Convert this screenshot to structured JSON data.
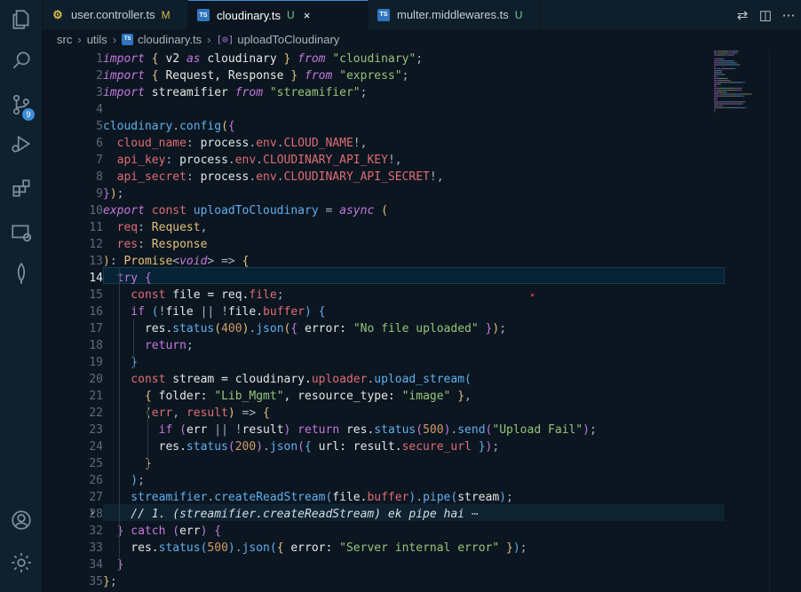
{
  "tabs": [
    {
      "label": "user.controller.ts",
      "status": "M",
      "icon": "js-settings-icon"
    },
    {
      "label": "cloudinary.ts",
      "status": "U",
      "close": "×",
      "icon": "typescript-icon"
    },
    {
      "label": "multer.middlewares.ts",
      "status": "U",
      "icon": "typescript-icon"
    }
  ],
  "tab_badge_ts": "TS",
  "activity_badge": "9",
  "breadcrumb": {
    "parts": [
      "src",
      "utils",
      "cloudinary.ts",
      "uploadToCloudinary"
    ],
    "separator": "›"
  },
  "line_numbers": [
    "1",
    "2",
    "3",
    "4",
    "5",
    "6",
    "7",
    "8",
    "9",
    "10",
    "11",
    "12",
    "13",
    "14",
    "15",
    "16",
    "17",
    "18",
    "19",
    "20",
    "21",
    "22",
    "23",
    "24",
    "25",
    "26",
    "27",
    "28",
    "32",
    "33",
    "34",
    "35"
  ],
  "current_line": "14",
  "fold_chevron": "›",
  "code_tokens": [
    [
      [
        "kw",
        "import"
      ],
      [
        "pun",
        " "
      ],
      [
        "br1",
        "{"
      ],
      [
        "var",
        " v2 "
      ],
      [
        "kw",
        "as"
      ],
      [
        "var",
        " cloudinary "
      ],
      [
        "br1",
        "}"
      ],
      [
        "pun",
        " "
      ],
      [
        "kw",
        "from"
      ],
      [
        "pun",
        " "
      ],
      [
        "str",
        "\"cloudinary\""
      ],
      [
        "pun",
        ";"
      ]
    ],
    [
      [
        "kw",
        "import"
      ],
      [
        "pun",
        " "
      ],
      [
        "br1",
        "{"
      ],
      [
        "var",
        " Request, Response "
      ],
      [
        "br1",
        "}"
      ],
      [
        "pun",
        " "
      ],
      [
        "kw",
        "from"
      ],
      [
        "pun",
        " "
      ],
      [
        "str",
        "\"express\""
      ],
      [
        "pun",
        ";"
      ]
    ],
    [
      [
        "kw",
        "import"
      ],
      [
        "var",
        " streamifier "
      ],
      [
        "kw",
        "from"
      ],
      [
        "pun",
        " "
      ],
      [
        "str",
        "\"streamifier\""
      ],
      [
        "pun",
        ";"
      ]
    ],
    [],
    [
      [
        "fn",
        "cloudinary"
      ],
      [
        "pun",
        "."
      ],
      [
        "fn",
        "config"
      ],
      [
        "br1",
        "("
      ],
      [
        "br2",
        "{"
      ]
    ],
    [
      [
        "prop",
        "  cloud_name"
      ],
      [
        "pun",
        ": "
      ],
      [
        "var",
        "process"
      ],
      [
        "pun",
        "."
      ],
      [
        "prop",
        "env"
      ],
      [
        "pun",
        "."
      ],
      [
        "env",
        "CLOUD_NAME"
      ],
      [
        "pun",
        "!,"
      ]
    ],
    [
      [
        "prop",
        "  api_key"
      ],
      [
        "pun",
        ": "
      ],
      [
        "var",
        "process"
      ],
      [
        "pun",
        "."
      ],
      [
        "prop",
        "env"
      ],
      [
        "pun",
        "."
      ],
      [
        "env",
        "CLOUDINARY_API_KEY"
      ],
      [
        "pun",
        "!,"
      ]
    ],
    [
      [
        "prop",
        "  api_secret"
      ],
      [
        "pun",
        ": "
      ],
      [
        "var",
        "process"
      ],
      [
        "pun",
        "."
      ],
      [
        "prop",
        "env"
      ],
      [
        "pun",
        "."
      ],
      [
        "env",
        "CLOUDINARY_API_SECRET"
      ],
      [
        "pun",
        "!,"
      ]
    ],
    [
      [
        "br2",
        "}"
      ],
      [
        "br1",
        ")"
      ],
      [
        "pun",
        ";"
      ]
    ],
    [
      [
        "kw",
        "export"
      ],
      [
        "pun",
        " "
      ],
      [
        "kb",
        "const"
      ],
      [
        "pun",
        " "
      ],
      [
        "fn",
        "uploadToCloudinary"
      ],
      [
        "pun",
        " = "
      ],
      [
        "kw",
        "async"
      ],
      [
        "pun",
        " "
      ],
      [
        "br1",
        "("
      ]
    ],
    [
      [
        "prop",
        "  req"
      ],
      [
        "pun",
        ": "
      ],
      [
        "type",
        "Request"
      ],
      [
        "pun",
        ","
      ]
    ],
    [
      [
        "prop",
        "  res"
      ],
      [
        "pun",
        ": "
      ],
      [
        "type",
        "Response"
      ]
    ],
    [
      [
        "br1",
        ")"
      ],
      [
        "pun",
        ": "
      ],
      [
        "type",
        "Promise"
      ],
      [
        "pun",
        "<"
      ],
      [
        "kw",
        "void"
      ],
      [
        "pun",
        "> => "
      ],
      [
        "br1",
        "{"
      ]
    ],
    [
      [
        "ctl",
        "  try"
      ],
      [
        "pun",
        " "
      ],
      [
        "br2",
        "{"
      ]
    ],
    [
      [
        "kb",
        "    const"
      ],
      [
        "var",
        " file = req."
      ],
      [
        "prop",
        "file"
      ],
      [
        "pun",
        ";"
      ]
    ],
    [
      [
        "ctl",
        "    if"
      ],
      [
        "pun",
        " "
      ],
      [
        "br3",
        "("
      ],
      [
        "pun",
        "!"
      ],
      [
        "var",
        "file "
      ],
      [
        "pun",
        "||"
      ],
      [
        "pun",
        " !"
      ],
      [
        "var",
        "file."
      ],
      [
        "prop",
        "buffer"
      ],
      [
        "br3",
        ")"
      ],
      [
        "pun",
        " "
      ],
      [
        "br3",
        "{"
      ]
    ],
    [
      [
        "var",
        "      res."
      ],
      [
        "fn",
        "status"
      ],
      [
        "br1",
        "("
      ],
      [
        "num",
        "400"
      ],
      [
        "br1",
        ")"
      ],
      [
        "pun",
        "."
      ],
      [
        "fn",
        "json"
      ],
      [
        "br1",
        "("
      ],
      [
        "br2",
        "{"
      ],
      [
        "var",
        " error: "
      ],
      [
        "str",
        "\"No file uploaded\""
      ],
      [
        "pun",
        " "
      ],
      [
        "br2",
        "}"
      ],
      [
        "br1",
        ")"
      ],
      [
        "pun",
        ";"
      ]
    ],
    [
      [
        "ctl",
        "      return"
      ],
      [
        "pun",
        ";"
      ]
    ],
    [
      [
        "br3",
        "    }"
      ]
    ],
    [
      [
        "kb",
        "    const"
      ],
      [
        "var",
        " stream = cloudinary."
      ],
      [
        "prop",
        "uploader"
      ],
      [
        "pun",
        "."
      ],
      [
        "fn",
        "upload_stream"
      ],
      [
        "br3",
        "("
      ]
    ],
    [
      [
        "br1",
        "      {"
      ],
      [
        "var",
        " folder: "
      ],
      [
        "str",
        "\"Lib_Mgmt\""
      ],
      [
        "var",
        ", resource_type: "
      ],
      [
        "str",
        "\"image\""
      ],
      [
        "pun",
        " "
      ],
      [
        "br1",
        "}"
      ],
      [
        "pun",
        ","
      ]
    ],
    [
      [
        "br1",
        "      ("
      ],
      [
        "prop",
        "err"
      ],
      [
        "pun",
        ", "
      ],
      [
        "prop",
        "result"
      ],
      [
        "br1",
        ")"
      ],
      [
        "pun",
        " => "
      ],
      [
        "br1",
        "{"
      ]
    ],
    [
      [
        "ctl",
        "        if"
      ],
      [
        "pun",
        " "
      ],
      [
        "br2",
        "("
      ],
      [
        "var",
        "err "
      ],
      [
        "pun",
        "||"
      ],
      [
        "pun",
        " !"
      ],
      [
        "var",
        "result"
      ],
      [
        "br2",
        ")"
      ],
      [
        "ctl",
        " return"
      ],
      [
        "var",
        " res."
      ],
      [
        "fn",
        "status"
      ],
      [
        "br2",
        "("
      ],
      [
        "num",
        "500"
      ],
      [
        "br2",
        ")"
      ],
      [
        "pun",
        "."
      ],
      [
        "fn",
        "send"
      ],
      [
        "br2",
        "("
      ],
      [
        "str",
        "\"Upload Fail\""
      ],
      [
        "br2",
        ")"
      ],
      [
        "pun",
        ";"
      ]
    ],
    [
      [
        "var",
        "        res."
      ],
      [
        "fn",
        "status"
      ],
      [
        "br2",
        "("
      ],
      [
        "num",
        "200"
      ],
      [
        "br2",
        ")"
      ],
      [
        "pun",
        "."
      ],
      [
        "fn",
        "json"
      ],
      [
        "br2",
        "("
      ],
      [
        "br3",
        "{"
      ],
      [
        "var",
        " url: result."
      ],
      [
        "prop",
        "secure_url"
      ],
      [
        "pun",
        " "
      ],
      [
        "br3",
        "}"
      ],
      [
        "br2",
        ")"
      ],
      [
        "pun",
        ";"
      ]
    ],
    [
      [
        "br1",
        "      }"
      ]
    ],
    [
      [
        "br3",
        "    )"
      ],
      [
        "pun",
        ";"
      ]
    ],
    [
      [
        "fn",
        "    streamifier"
      ],
      [
        "pun",
        "."
      ],
      [
        "fn",
        "createReadStream"
      ],
      [
        "br3",
        "("
      ],
      [
        "var",
        "file."
      ],
      [
        "prop",
        "buffer"
      ],
      [
        "br3",
        ")"
      ],
      [
        "pun",
        "."
      ],
      [
        "fn",
        "pipe"
      ],
      [
        "br3",
        "("
      ],
      [
        "var",
        "stream"
      ],
      [
        "br3",
        ")"
      ],
      [
        "pun",
        ";"
      ]
    ],
    [
      [
        "cm",
        "    // 1. (streamifier.createReadStream) ek pipe hai"
      ],
      [
        "pun",
        " ⋯"
      ]
    ],
    [
      [
        "br2",
        "  }"
      ],
      [
        "ctl",
        " catch"
      ],
      [
        "pun",
        " "
      ],
      [
        "br2",
        "("
      ],
      [
        "var",
        "err"
      ],
      [
        "br2",
        ")"
      ],
      [
        "pun",
        " "
      ],
      [
        "br2",
        "{"
      ]
    ],
    [
      [
        "var",
        "    res."
      ],
      [
        "fn",
        "status"
      ],
      [
        "br3",
        "("
      ],
      [
        "num",
        "500"
      ],
      [
        "br3",
        ")"
      ],
      [
        "pun",
        "."
      ],
      [
        "fn",
        "json"
      ],
      [
        "br3",
        "("
      ],
      [
        "br1",
        "{"
      ],
      [
        "var",
        " error: "
      ],
      [
        "str",
        "\"Server internal error\""
      ],
      [
        "pun",
        " "
      ],
      [
        "br1",
        "}"
      ],
      [
        "br3",
        ")"
      ],
      [
        "pun",
        ";"
      ]
    ],
    [
      [
        "br2",
        "  }"
      ]
    ],
    [
      [
        "br1",
        "}"
      ],
      [
        "pun",
        ";"
      ]
    ]
  ],
  "colors": {
    "background": "#0b1620",
    "activity_bar": "#10212e",
    "tab_accent": "#3b8ed8",
    "keyword": "#c678dd",
    "string": "#98c379",
    "function": "#61afef",
    "number": "#d19a66"
  }
}
